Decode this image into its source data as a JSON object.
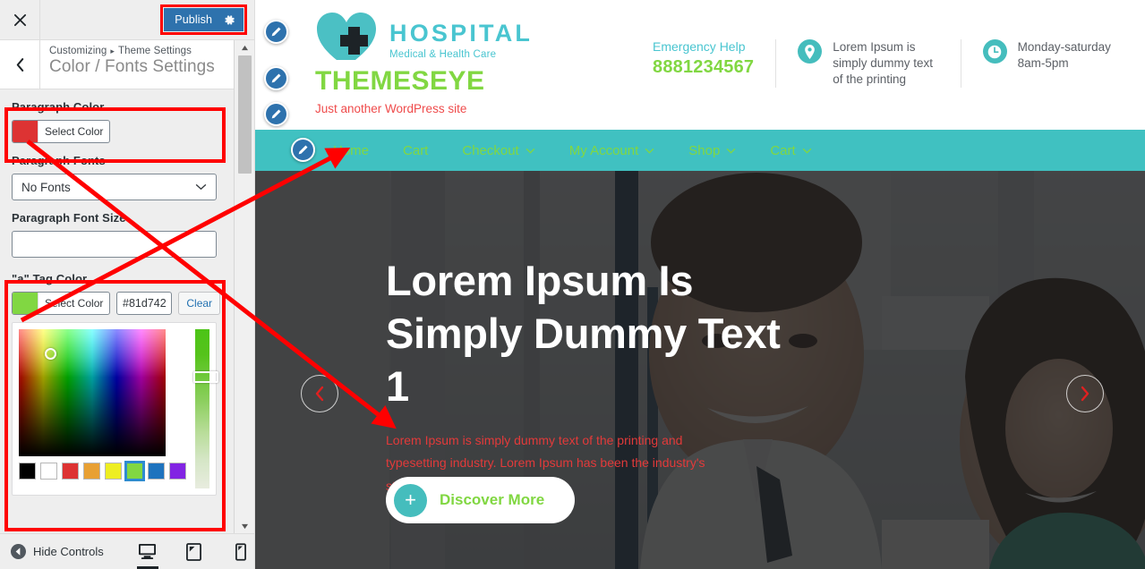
{
  "customizer": {
    "close_icon": "close-icon",
    "publish_label": "Publish",
    "gear_icon": "gear-icon",
    "back_icon": "chevron-left-icon",
    "breadcrumb_root": "Customizing",
    "breadcrumb_sep": "▸",
    "breadcrumb_section": "Theme Settings",
    "panel_title": "Color / Fonts Settings",
    "controls": {
      "paragraph_color_label": "Paragraph Color",
      "paragraph_color_select": "Select Color",
      "paragraph_color_value": "#dd3333",
      "paragraph_fonts_label": "Paragraph Fonts",
      "paragraph_fonts_value": "No Fonts",
      "paragraph_font_size_label": "Paragraph Font Size",
      "paragraph_font_size_value": "",
      "a_tag_color_label": "\"a\" Tag Color",
      "a_tag_color_select": "Select Color",
      "a_tag_color_hex": "#81d742",
      "a_tag_color_clear": "Clear"
    },
    "picker_swatches": [
      {
        "name": "black",
        "hex": "#000000",
        "selected": false
      },
      {
        "name": "white",
        "hex": "#ffffff",
        "selected": false
      },
      {
        "name": "red",
        "hex": "#dd3333",
        "selected": false
      },
      {
        "name": "orange",
        "hex": "#e8a033",
        "selected": false
      },
      {
        "name": "yellow",
        "hex": "#eeee22",
        "selected": false
      },
      {
        "name": "green",
        "hex": "#81d742",
        "selected": true
      },
      {
        "name": "blue",
        "hex": "#1e73be",
        "selected": false
      },
      {
        "name": "purple",
        "hex": "#8224e3",
        "selected": false
      }
    ],
    "footer": {
      "hide_controls_label": "Hide Controls",
      "hide_controls_icon": "collapse-left-icon",
      "devices": [
        {
          "name": "desktop-preview",
          "icon": "desktop-icon",
          "active": true
        },
        {
          "name": "tablet-preview",
          "icon": "tablet-icon",
          "active": false
        },
        {
          "name": "mobile-preview",
          "icon": "mobile-icon",
          "active": false
        }
      ]
    }
  },
  "site": {
    "logo": {
      "heart_icon": "heart-plus-logo-icon",
      "name": "HOSPITAL",
      "tagline": "Medical & Health Care"
    },
    "title": "THEMESEYE",
    "description": "Just another WordPress site",
    "info": [
      {
        "name": "emergency-help",
        "label": "Emergency Help",
        "value": "8881234567"
      },
      {
        "name": "address",
        "icon": "map-pin-icon",
        "value": "Lorem Ipsum is simply dummy text of the printing"
      },
      {
        "name": "opening-hours",
        "icon": "clock-icon",
        "value": "Monday-saturday 8am-5pm"
      }
    ],
    "nav": [
      {
        "label": "Home",
        "has_caret": false
      },
      {
        "label": "Cart",
        "has_caret": false
      },
      {
        "label": "Checkout",
        "has_caret": true
      },
      {
        "label": "My Account",
        "has_caret": true
      },
      {
        "label": "Shop",
        "has_caret": true
      },
      {
        "label": "Cart",
        "has_caret": true
      }
    ],
    "hero": {
      "heading": "Lorem Ipsum Is Simply Dummy Text 1",
      "paragraph": "Lorem Ipsum is simply dummy text of the printing and typesetting industry. Lorem Ipsum has been the industry's standard dummy text",
      "button_label": "Discover More",
      "button_icon": "plus-icon",
      "prev_icon": "chevron-left-icon",
      "next_icon": "chevron-right-icon",
      "heading_color": "#ffffff",
      "paragraph_color": "#e23a3a"
    },
    "edit_pencils": [
      {
        "name": "edit-logo-pencil",
        "icon": "pencil-icon"
      },
      {
        "name": "edit-site-title-pencil",
        "icon": "pencil-icon"
      },
      {
        "name": "edit-tagline-pencil",
        "icon": "pencil-icon"
      },
      {
        "name": "edit-menu-pencil",
        "icon": "pencil-icon"
      }
    ]
  },
  "annotations": {
    "highlight_color": "#ff0000",
    "boxes": [
      {
        "name": "highlight-publish-button"
      },
      {
        "name": "highlight-paragraph-color-control"
      },
      {
        "name": "highlight-a-tag-color-control"
      }
    ],
    "arrows": [
      {
        "name": "arrow-paragraph-color-to-hero-paragraph"
      },
      {
        "name": "arrow-a-tag-color-to-home-link"
      }
    ]
  }
}
